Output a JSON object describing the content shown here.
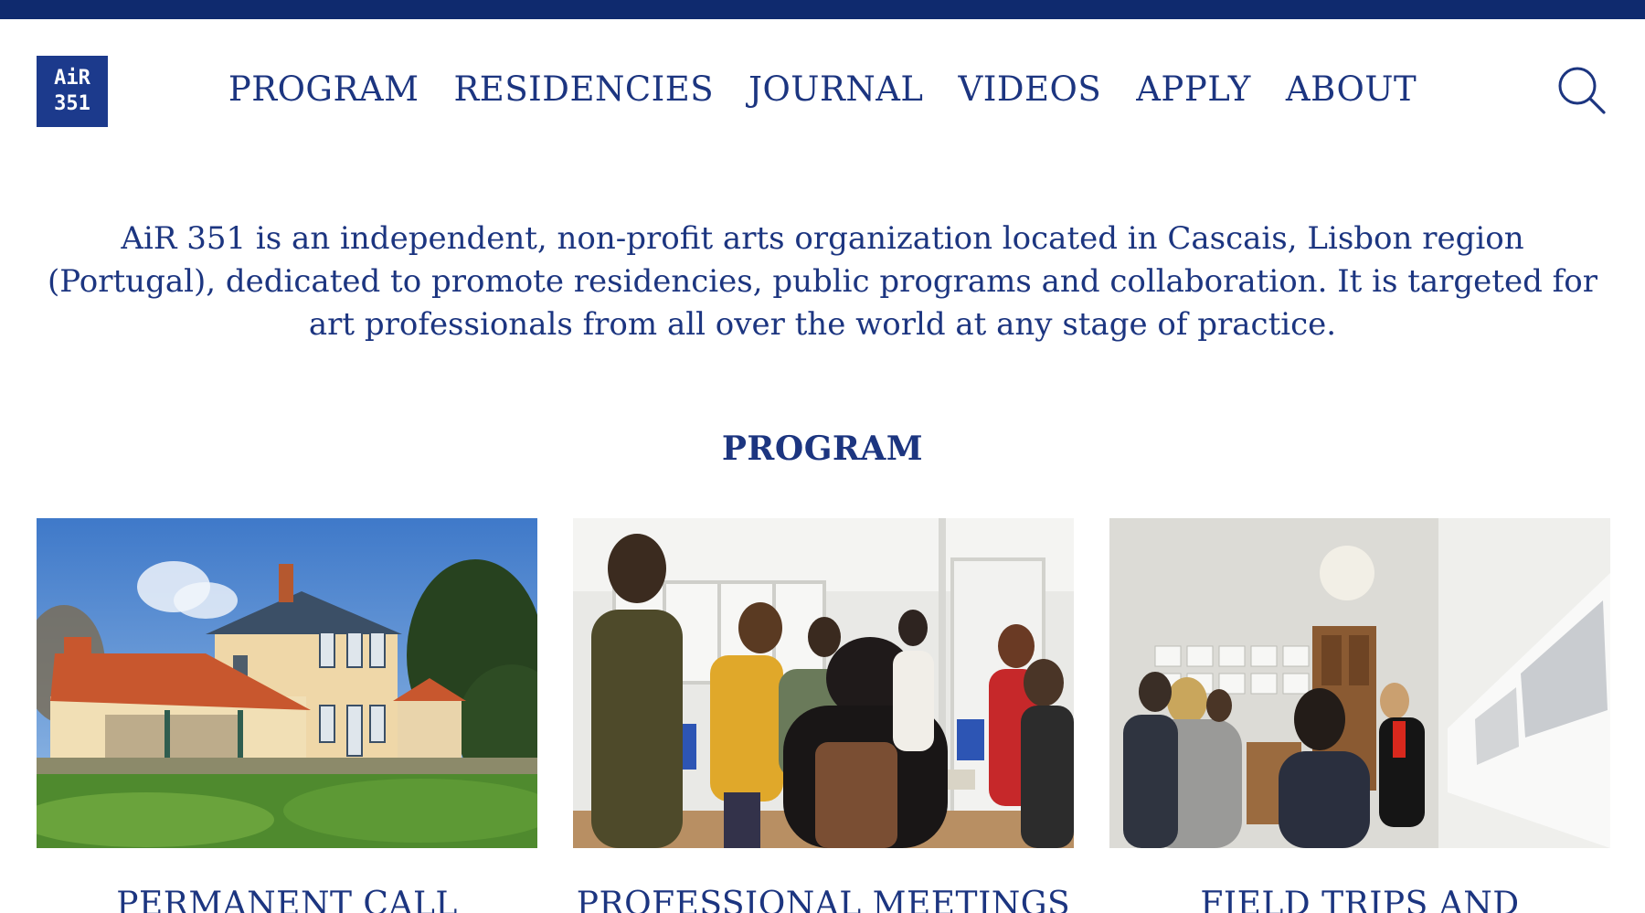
{
  "brand": {
    "logo_line1": "AiR",
    "logo_line2": "351",
    "color": "#1c3a8c",
    "top_bar_color": "#0f2a6e"
  },
  "nav": {
    "items": [
      "PROGRAM",
      "RESIDENCIES",
      "JOURNAL",
      "VIDEOS",
      "APPLY",
      "ABOUT"
    ],
    "search_icon": "search-icon"
  },
  "intro": "AiR 351 is an independent, non-profit arts organization located in Cascais, Lisbon region (Portugal), dedicated to promote residencies, public programs and collaboration. It is targeted for art professionals from all over the world at any stage of practice.",
  "program": {
    "title": "PROGRAM",
    "cards": [
      {
        "title": "PERMANENT CALL",
        "image": "house-with-garden-photo"
      },
      {
        "title": "PROFESSIONAL MEETINGS",
        "image": "group-meeting-photo"
      },
      {
        "title": "FIELD TRIPS AND",
        "image": "studio-visit-photo"
      }
    ]
  }
}
